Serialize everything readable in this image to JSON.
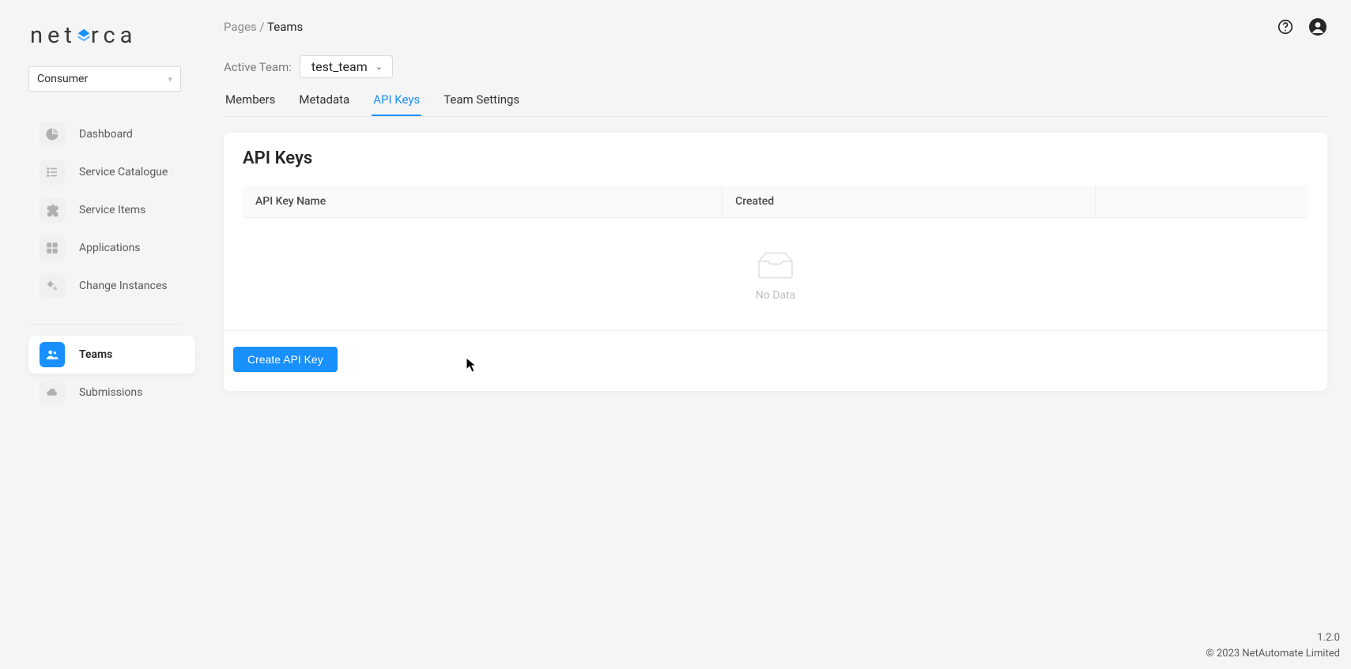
{
  "logo": {
    "pre": "net",
    "post": "rca"
  },
  "role_selector": {
    "value": "Consumer"
  },
  "sidebar": {
    "items_top": [
      {
        "label": "Dashboard",
        "icon": "pie-icon"
      },
      {
        "label": "Service Catalogue",
        "icon": "list-icon"
      },
      {
        "label": "Service Items",
        "icon": "puzzle-icon"
      },
      {
        "label": "Applications",
        "icon": "grid-icon"
      },
      {
        "label": "Change Instances",
        "icon": "gears-icon"
      }
    ],
    "items_bottom": [
      {
        "label": "Teams",
        "icon": "team-icon",
        "active": true
      },
      {
        "label": "Submissions",
        "icon": "cloud-icon"
      }
    ]
  },
  "breadcrumb": {
    "root": "Pages",
    "sep": "/",
    "current": "Teams"
  },
  "active_team": {
    "label": "Active Team:",
    "value": "test_team"
  },
  "tabs": [
    {
      "label": "Members"
    },
    {
      "label": "Metadata"
    },
    {
      "label": "API Keys",
      "active": true
    },
    {
      "label": "Team Settings"
    }
  ],
  "panel": {
    "title": "API Keys",
    "columns": {
      "name": "API Key Name",
      "created": "Created",
      "actions": ""
    },
    "rows": [],
    "empty_text": "No Data",
    "create_button": "Create API Key"
  },
  "footer": {
    "version": "1.2.0",
    "copyright": "© 2023 NetAutomate Limited"
  }
}
